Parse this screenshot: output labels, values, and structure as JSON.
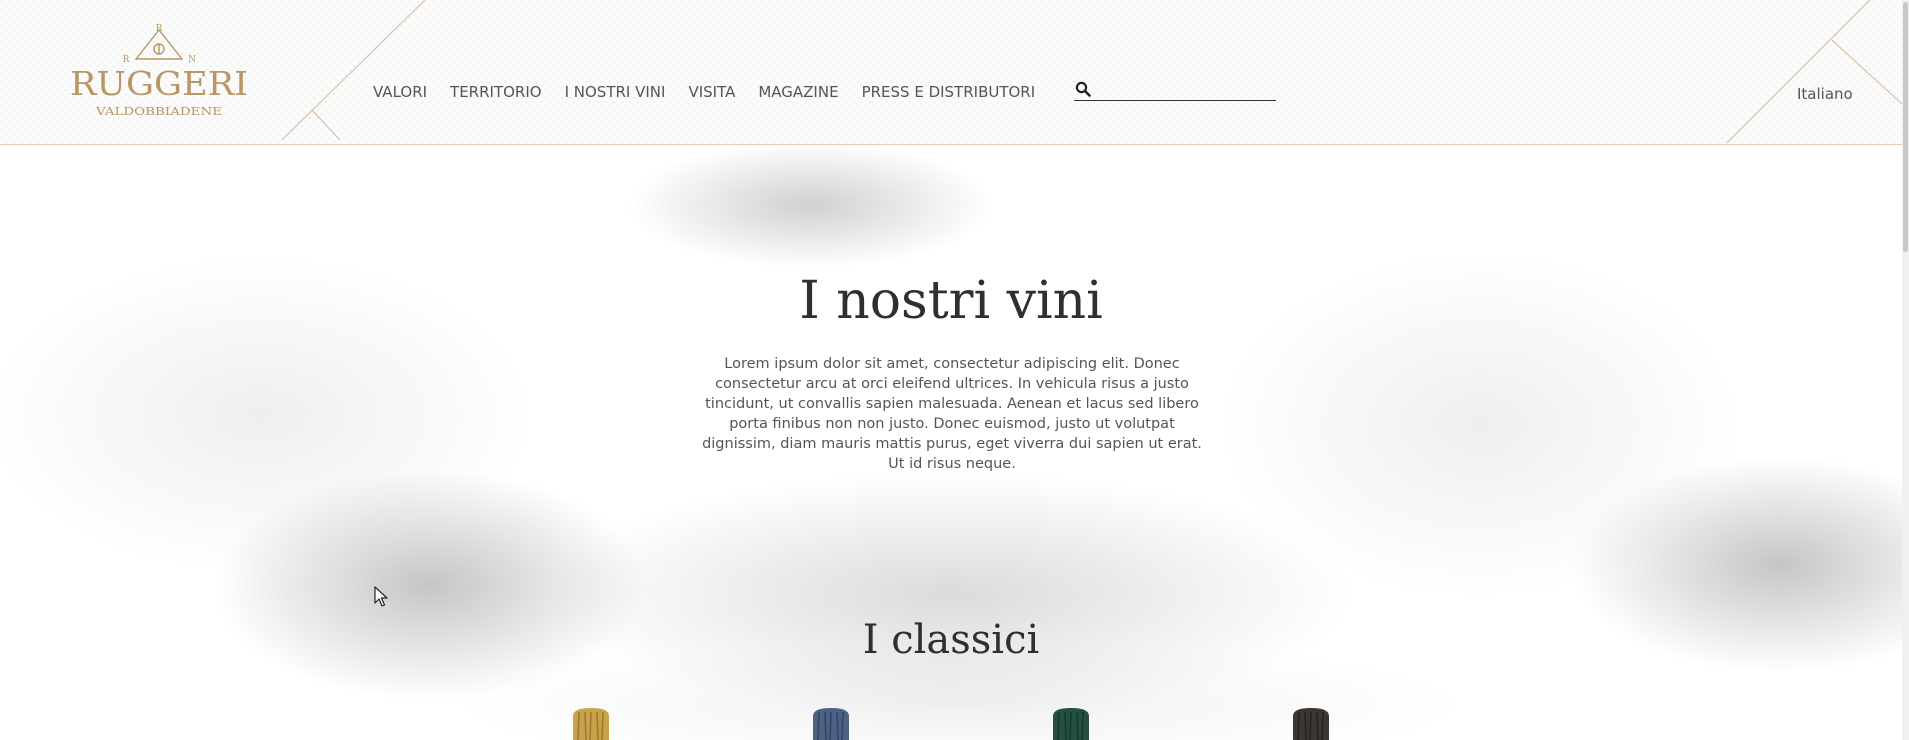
{
  "brand": {
    "name": "RUGGERI",
    "subtitle": "VALDOBBIADENE",
    "monogram_left": "R",
    "monogram_top": "R",
    "monogram_right": "N",
    "color": "#b99663"
  },
  "nav": {
    "items": [
      {
        "label": "VALORI"
      },
      {
        "label": "TERRITORIO"
      },
      {
        "label": "I NOSTRI VINI"
      },
      {
        "label": "VISITA"
      },
      {
        "label": "MAGAZINE"
      },
      {
        "label": "PRESS E DISTRIBUTORI"
      }
    ]
  },
  "search": {
    "value": "",
    "placeholder": "",
    "icon": "search-icon"
  },
  "language": {
    "selected": "Italiano"
  },
  "intro": {
    "title": "I nostri vini",
    "text": "Lorem ipsum dolor sit amet, consectetur adipiscing elit. Donec consectetur arcu at orci eleifend ultrices. In vehicula risus a justo tincidunt, ut convallis sapien malesuada. Aenean et lacus sed libero porta finibus non non justo. Donec euismod, justo ut volutpat dignissim, diam mauris mattis purus, eget viverra dui sapien ut erat. Ut id risus neque."
  },
  "section": {
    "title": "I classici"
  },
  "bottles": [
    {
      "foil_color": "#c9a24a",
      "shade_color": "#8a6a25"
    },
    {
      "foil_color": "#4d6185",
      "shade_color": "#2c3a55"
    },
    {
      "foil_color": "#24503f",
      "shade_color": "#123026"
    },
    {
      "foil_color": "#3b3533",
      "shade_color": "#1e1a19"
    }
  ],
  "colors": {
    "accent": "#b99663",
    "header_border": "#e5ccb3",
    "text": "#555555",
    "heading": "#2f2f2f"
  }
}
